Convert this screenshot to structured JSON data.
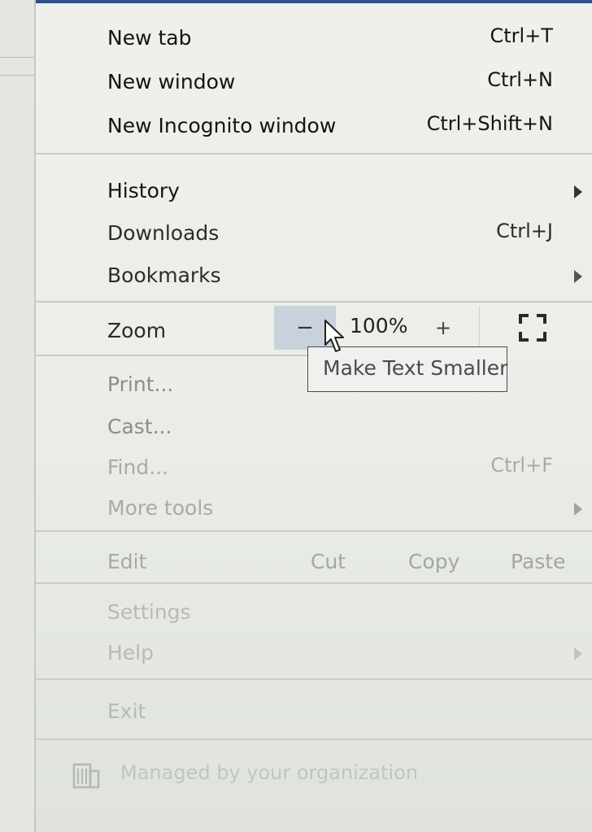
{
  "menu": {
    "new_tab": {
      "label": "New tab",
      "shortcut": "Ctrl+T"
    },
    "new_window": {
      "label": "New window",
      "shortcut": "Ctrl+N"
    },
    "new_incognito": {
      "label": "New Incognito window",
      "shortcut": "Ctrl+Shift+N"
    },
    "history": {
      "label": "History"
    },
    "downloads": {
      "label": "Downloads",
      "shortcut": "Ctrl+J"
    },
    "bookmarks": {
      "label": "Bookmarks"
    },
    "zoom": {
      "label": "Zoom",
      "minus": "−",
      "level": "100%",
      "plus": "+"
    },
    "print": {
      "label": "Print..."
    },
    "cast": {
      "label": "Cast..."
    },
    "find": {
      "label": "Find...",
      "shortcut": "Ctrl+F"
    },
    "more_tools": {
      "label": "More tools"
    },
    "edit": {
      "label": "Edit",
      "cut": "Cut",
      "copy": "Copy",
      "paste": "Paste"
    },
    "settings": {
      "label": "Settings"
    },
    "help": {
      "label": "Help"
    },
    "exit": {
      "label": "Exit"
    },
    "managed": {
      "label": "Managed by your organization"
    }
  },
  "tooltip": {
    "text": "Make Text Smaller"
  },
  "icons": {
    "submenu": "chevron-right-icon",
    "fullscreen": "fullscreen-icon",
    "managed": "building-icon",
    "cursor": "mouse-pointer-icon"
  },
  "colors": {
    "zoom_hover": "#c9d1dc",
    "accent_bar": "#2f4f86"
  }
}
